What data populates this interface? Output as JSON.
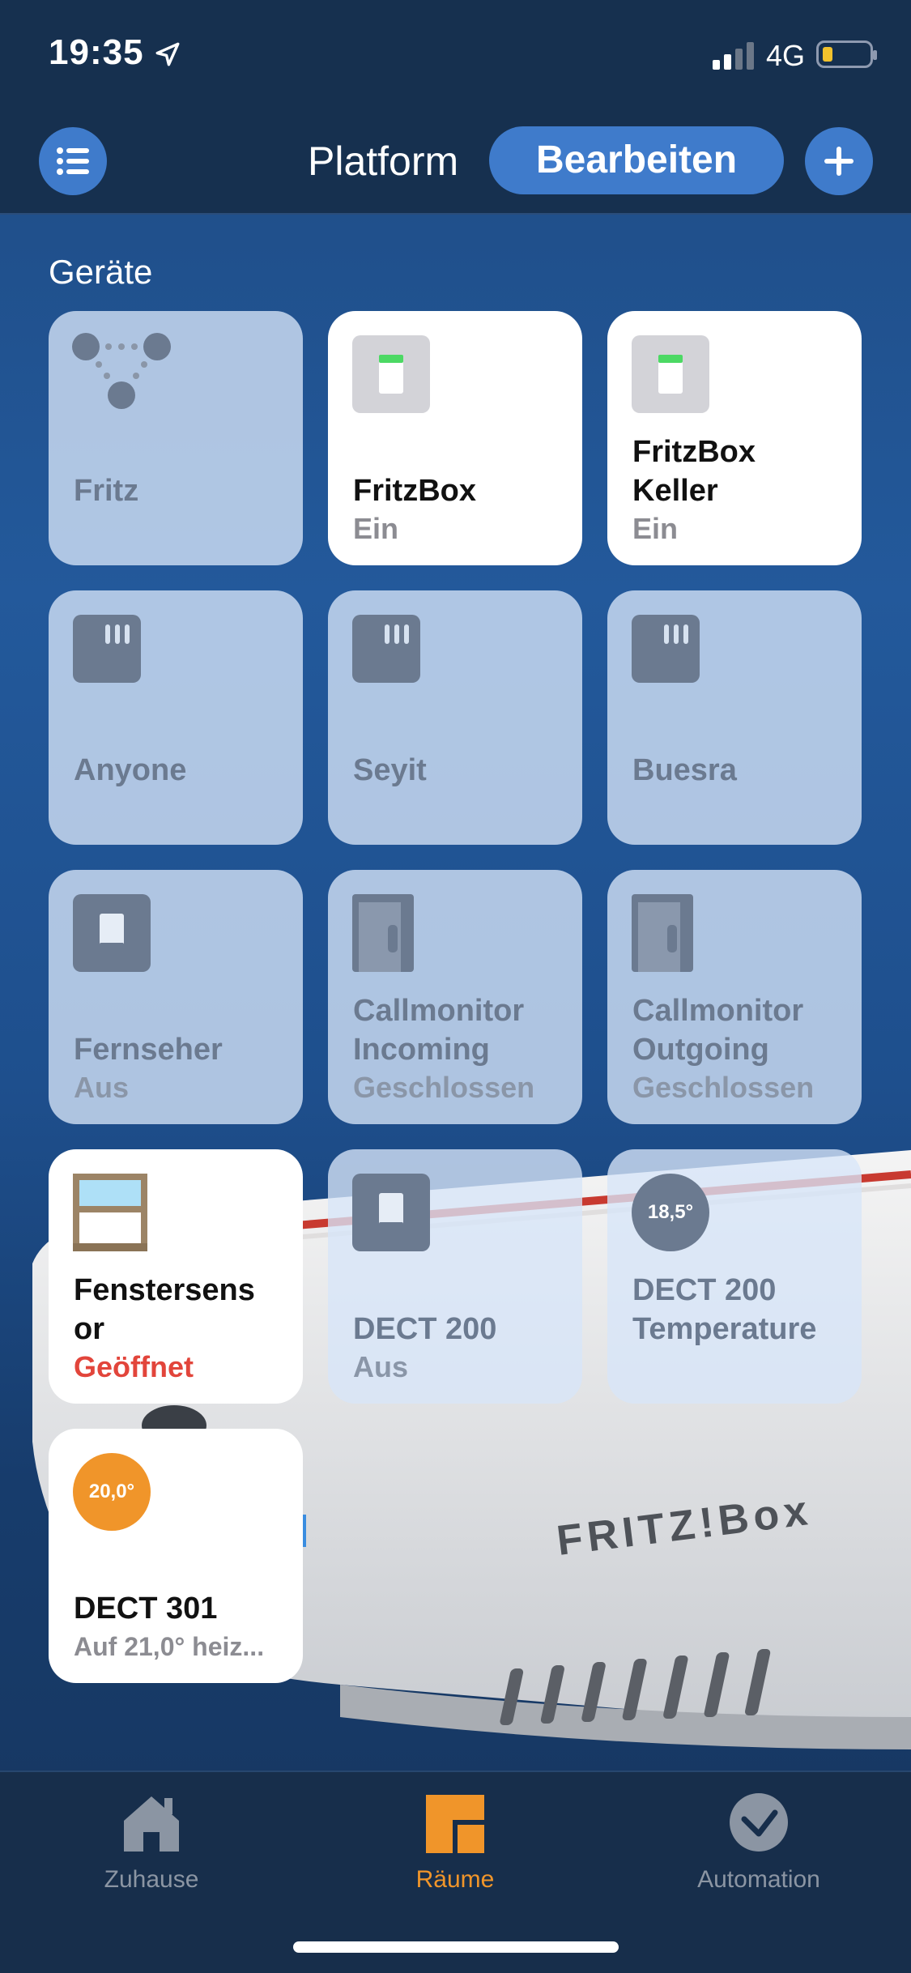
{
  "status_bar": {
    "time": "19:35",
    "network": "4G"
  },
  "nav": {
    "title": "Platform",
    "edit_label": "Bearbeiten"
  },
  "section_title": "Geräte",
  "router_brand": "FRITZ!Box",
  "tiles": [
    {
      "name": "Fritz",
      "status": "",
      "state": "off",
      "icon": "hub-icon"
    },
    {
      "name": "FritzBox",
      "status": "Ein",
      "state": "on",
      "icon": "switch-on-icon"
    },
    {
      "name": "FritzBox\nKeller",
      "status": "Ein",
      "state": "on",
      "icon": "switch-on-icon"
    },
    {
      "name": "Anyone",
      "status": "",
      "state": "off",
      "icon": "person-sensor-icon"
    },
    {
      "name": "Seyit",
      "status": "",
      "state": "off",
      "icon": "person-sensor-icon"
    },
    {
      "name": "Buesra",
      "status": "",
      "state": "off",
      "icon": "person-sensor-icon"
    },
    {
      "name": "Fernseher",
      "status": "Aus",
      "state": "off",
      "icon": "switch-off-icon"
    },
    {
      "name": "Callmonitor\nIncoming",
      "status": "Geschlossen",
      "state": "off",
      "icon": "door-icon"
    },
    {
      "name": "Callmonitor\nOutgoing",
      "status": "Geschlossen",
      "state": "off",
      "icon": "door-icon"
    },
    {
      "name": "Fenstersens\nor",
      "status": "Geöffnet",
      "state": "on",
      "icon": "window-icon"
    },
    {
      "name": "DECT 200",
      "status": "Aus",
      "state": "off",
      "icon": "switch-off-icon"
    },
    {
      "name": "DECT 200\nTemperature",
      "status": "",
      "state": "off",
      "icon": "temperature-icon",
      "temp": "18,5°"
    },
    {
      "name": "DECT 301",
      "status": "Auf 21,0° heiz...",
      "state": "on",
      "icon": "thermostat-icon",
      "temp": "20,0°"
    }
  ],
  "tabs": [
    {
      "label": "Zuhause",
      "active": false
    },
    {
      "label": "Räume",
      "active": true
    },
    {
      "label": "Automation",
      "active": false
    }
  ],
  "colors": {
    "accent": "#f0952a",
    "button_blue": "#3f7bcb",
    "alert_red": "#e2453b",
    "tab_inactive": "#8b95a3"
  }
}
